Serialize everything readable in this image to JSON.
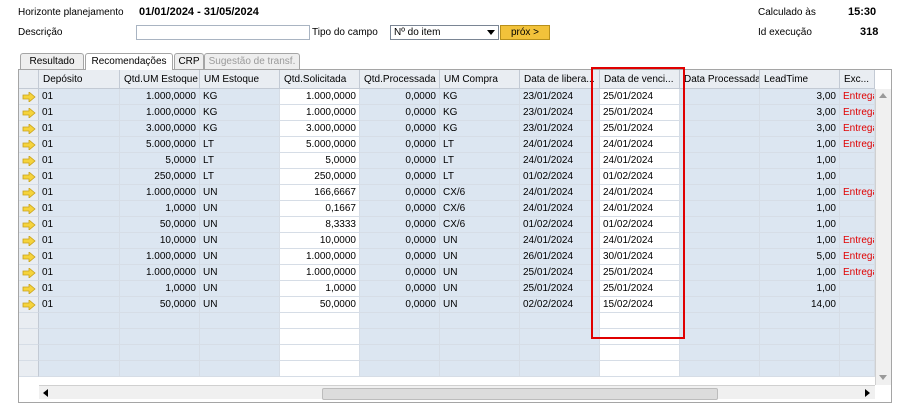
{
  "header": {
    "horizonte_label": "Horizonte planejamento",
    "horizonte_value": "01/01/2024 - 31/05/2024",
    "descricao_label": "Descrição",
    "descricao_value": "",
    "tipo_campo_label": "Tipo do campo",
    "tipo_campo_value": "Nº do item",
    "prox_button": "próx >",
    "calculado_label": "Calculado às",
    "calculado_value": "15:30",
    "id_execucao_label": "Id execução",
    "id_execucao_value": "318"
  },
  "tabs": [
    {
      "label": "Resultado",
      "state": "normal"
    },
    {
      "label": "Recomendações",
      "state": "active"
    },
    {
      "label": "CRP",
      "state": "normal"
    },
    {
      "label": "Sugestão de transf.",
      "state": "disabled"
    }
  ],
  "columns": [
    "Depósito",
    "Qtd.UM Estoque",
    "UM Estoque",
    "Qtd.Solicitada",
    "Qtd.Processada",
    "UM Compra",
    "Data de libera...",
    "Data de venci...",
    "Data Processada",
    "LeadTime",
    "Exc..."
  ],
  "rows": [
    [
      "01",
      "1.000,0000",
      "KG",
      "1.000,0000",
      "0,0000",
      "KG",
      "23/01/2024",
      "25/01/2024",
      "",
      "3,00",
      "Entrega"
    ],
    [
      "01",
      "1.000,0000",
      "KG",
      "1.000,0000",
      "0,0000",
      "KG",
      "23/01/2024",
      "25/01/2024",
      "",
      "3,00",
      "Entrega"
    ],
    [
      "01",
      "3.000,0000",
      "KG",
      "3.000,0000",
      "0,0000",
      "KG",
      "23/01/2024",
      "25/01/2024",
      "",
      "3,00",
      "Entrega"
    ],
    [
      "01",
      "5.000,0000",
      "LT",
      "5.000,0000",
      "0,0000",
      "LT",
      "24/01/2024",
      "24/01/2024",
      "",
      "1,00",
      "Entrega"
    ],
    [
      "01",
      "5,0000",
      "LT",
      "5,0000",
      "0,0000",
      "LT",
      "24/01/2024",
      "24/01/2024",
      "",
      "1,00",
      ""
    ],
    [
      "01",
      "250,0000",
      "LT",
      "250,0000",
      "0,0000",
      "LT",
      "01/02/2024",
      "01/02/2024",
      "",
      "1,00",
      ""
    ],
    [
      "01",
      "1.000,0000",
      "UN",
      "166,6667",
      "0,0000",
      "CX/6",
      "24/01/2024",
      "24/01/2024",
      "",
      "1,00",
      "Entrega"
    ],
    [
      "01",
      "1,0000",
      "UN",
      "0,1667",
      "0,0000",
      "CX/6",
      "24/01/2024",
      "24/01/2024",
      "",
      "1,00",
      ""
    ],
    [
      "01",
      "50,0000",
      "UN",
      "8,3333",
      "0,0000",
      "CX/6",
      "01/02/2024",
      "01/02/2024",
      "",
      "1,00",
      ""
    ],
    [
      "01",
      "10,0000",
      "UN",
      "10,0000",
      "0,0000",
      "UN",
      "24/01/2024",
      "24/01/2024",
      "",
      "1,00",
      "Entrega"
    ],
    [
      "01",
      "1.000,0000",
      "UN",
      "1.000,0000",
      "0,0000",
      "UN",
      "26/01/2024",
      "30/01/2024",
      "",
      "5,00",
      "Entrega"
    ],
    [
      "01",
      "1.000,0000",
      "UN",
      "1.000,0000",
      "0,0000",
      "UN",
      "25/01/2024",
      "25/01/2024",
      "",
      "1,00",
      "Entrega"
    ],
    [
      "01",
      "1,0000",
      "UN",
      "1,0000",
      "0,0000",
      "UN",
      "25/01/2024",
      "25/01/2024",
      "",
      "1,00",
      ""
    ],
    [
      "01",
      "50,0000",
      "UN",
      "50,0000",
      "0,0000",
      "UN",
      "02/02/2024",
      "15/02/2024",
      "",
      "14,00",
      ""
    ]
  ],
  "colors": {
    "row_bg": "#dce6f1",
    "editable_bg": "#ffffff",
    "highlight": "#e00000",
    "button": "#f2c23a",
    "exception_text": "#e00000"
  }
}
